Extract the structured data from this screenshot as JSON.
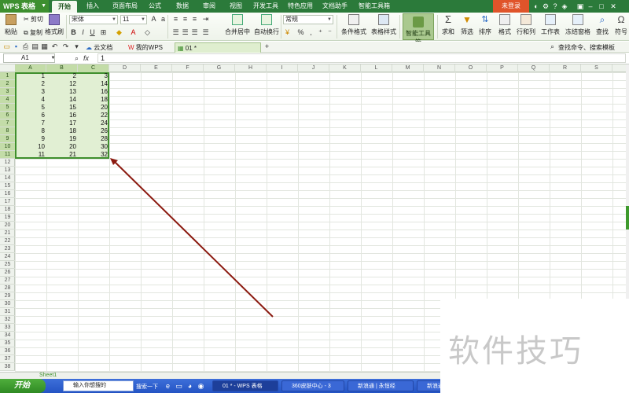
{
  "app": {
    "name": "WPS 表格",
    "login_label": "未登录",
    "menu_tabs": [
      "开始",
      "插入",
      "页面布局",
      "公式",
      "数据",
      "审阅",
      "视图",
      "开发工具",
      "特色应用",
      "文档助手",
      "智能工具箱"
    ],
    "active_tab": "开始"
  },
  "ribbon": {
    "paste": "粘贴",
    "cut": "剪切",
    "copy": "复制",
    "format_painter": "格式刷",
    "font_name": "宋体",
    "font_size": "11",
    "number_format": "常规",
    "merge_center": "合并居中",
    "wrap_text": "自动换行",
    "conditional_format": "条件格式",
    "table_style": "表格样式",
    "smart_toolbox": "智能工具箱",
    "sum": "求和",
    "filter": "筛选",
    "sort": "排序",
    "format": "格式",
    "row_col": "行和列",
    "worksheet": "工作表",
    "freeze": "冻结窗格",
    "find": "查找",
    "symbol": "符号",
    "percent": "%"
  },
  "quickbar": {
    "tabs": [
      "云文档",
      "我的WPS",
      "01 *"
    ],
    "active_index": 2,
    "search_hint": "查找命令、搜索模板"
  },
  "formula_bar": {
    "cell_ref": "A1",
    "fx": "fx",
    "value": "1"
  },
  "sheet": {
    "columns": [
      "A",
      "B",
      "C",
      "D",
      "E",
      "F",
      "G",
      "H",
      "I",
      "J",
      "K",
      "L",
      "M",
      "N",
      "O",
      "P",
      "Q",
      "R",
      "S"
    ],
    "row_count": 38,
    "rows": [
      [
        1,
        2,
        3
      ],
      [
        2,
        12,
        14
      ],
      [
        3,
        13,
        16
      ],
      [
        4,
        14,
        18
      ],
      [
        5,
        15,
        20
      ],
      [
        6,
        16,
        22
      ],
      [
        7,
        17,
        24
      ],
      [
        8,
        18,
        26
      ],
      [
        9,
        19,
        28
      ],
      [
        10,
        20,
        30
      ],
      [
        11,
        21,
        32
      ]
    ],
    "sheet_tab": "Sheet1"
  },
  "taskbar": {
    "start": "开始",
    "search_placeholder": "输入你想搜的",
    "search_btn": "搜索一下",
    "items": [
      "01 * - WPS 表格",
      "360皮肤中心 - 3",
      "新浪通 | 永恒经",
      "新浪通"
    ]
  },
  "watermark": "软件技巧",
  "colors": {
    "accent": "#3f8f2d",
    "selection": "#e1efd3",
    "arrow": "#8b1a10"
  }
}
